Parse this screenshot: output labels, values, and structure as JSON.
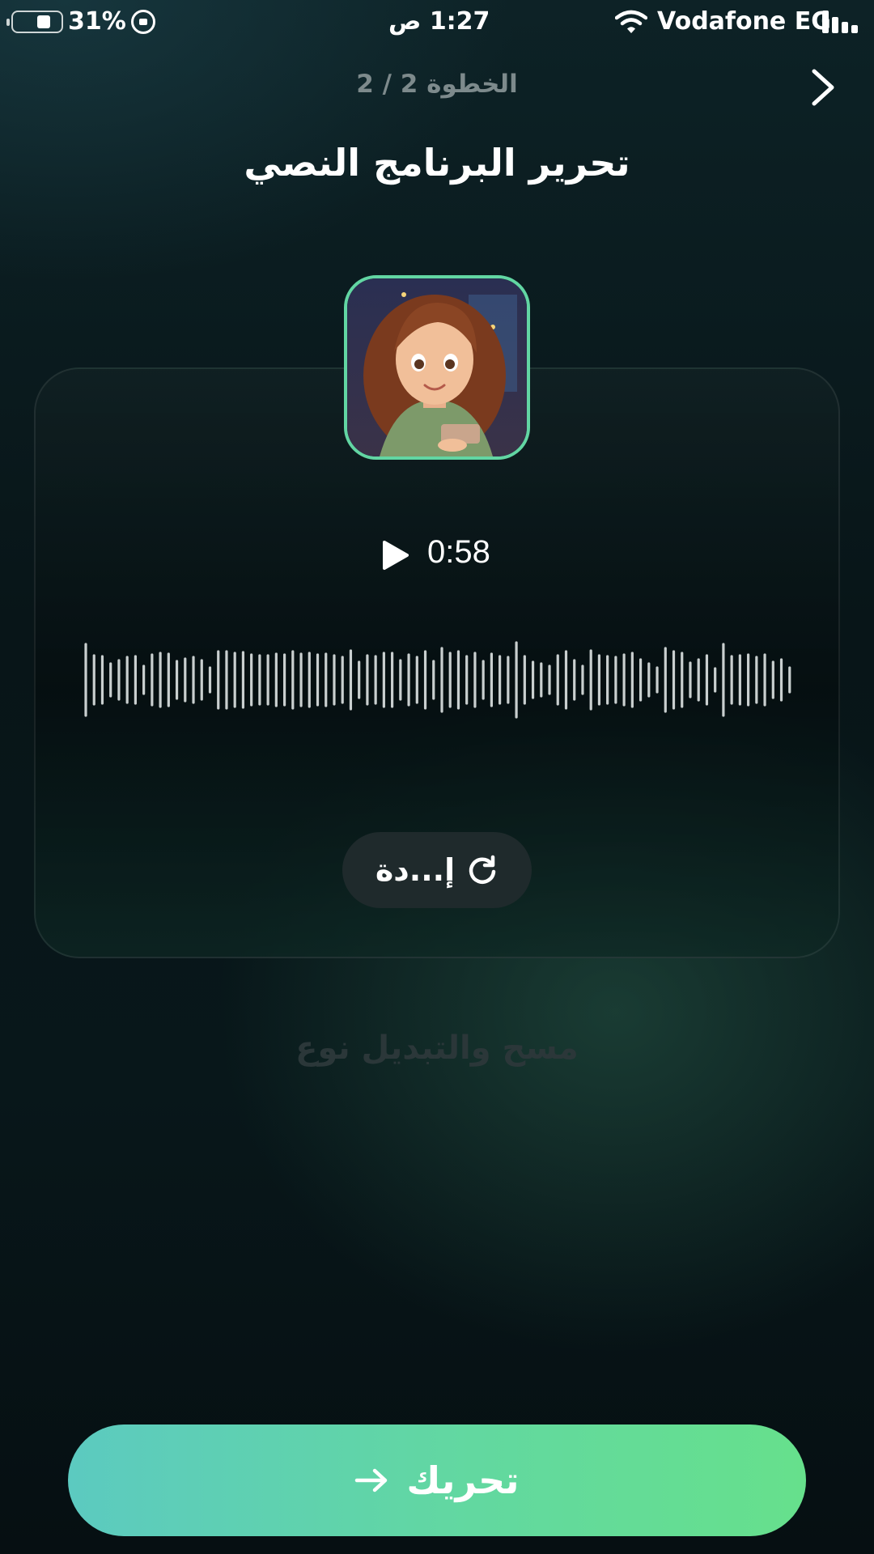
{
  "status_bar": {
    "battery": "31%",
    "time": "1:27 ص",
    "carrier": "Vodafone EG"
  },
  "header": {
    "step": "الخطوة 2 / 2",
    "title": "تحرير البرنامج النصي"
  },
  "player": {
    "duration": "0:58",
    "redo_label": "إ...دة"
  },
  "clear_label": "مسح والتبديل نوع",
  "cta_label": "تحريك",
  "colors": {
    "accent": "#62d6a3",
    "cta_start": "#5ccac0",
    "cta_end": "#66e08c"
  },
  "icons": [
    "battery-icon",
    "orientation-lock-icon",
    "wifi-icon",
    "signal-icon",
    "chevron-right-icon",
    "play-icon",
    "refresh-icon",
    "arrow-right-icon"
  ]
}
